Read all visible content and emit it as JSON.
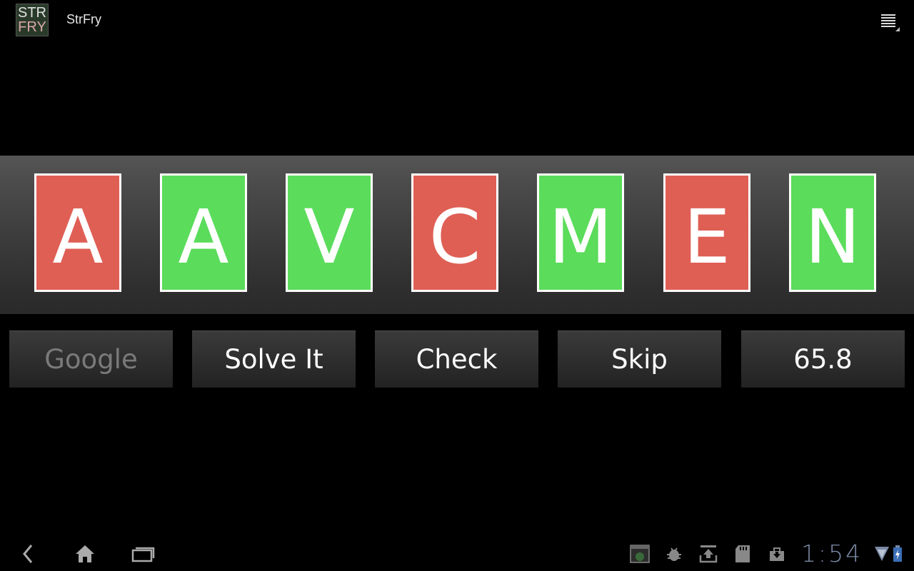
{
  "app": {
    "icon_line1": "STR",
    "icon_line2": "FRY",
    "title": "StrFry"
  },
  "tiles": [
    {
      "letter": "A",
      "state": "red"
    },
    {
      "letter": "A",
      "state": "green"
    },
    {
      "letter": "V",
      "state": "green"
    },
    {
      "letter": "C",
      "state": "red"
    },
    {
      "letter": "M",
      "state": "green"
    },
    {
      "letter": "E",
      "state": "red"
    },
    {
      "letter": "N",
      "state": "green"
    }
  ],
  "colors": {
    "tile_red": "#df5f55",
    "tile_green": "#5bdc5b",
    "clock": "#7b8aa5"
  },
  "buttons": {
    "google": "Google",
    "solve": "Solve It",
    "check": "Check",
    "skip": "Skip",
    "score": "65.8"
  },
  "status": {
    "clock": "1:54"
  }
}
